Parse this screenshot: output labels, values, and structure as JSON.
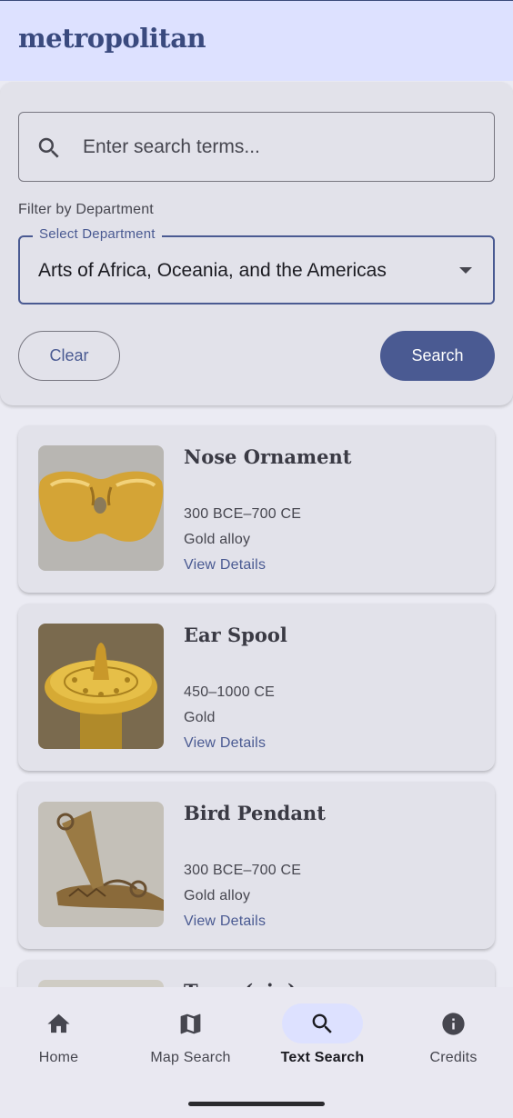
{
  "app": {
    "title": "metropolitan"
  },
  "search": {
    "placeholder": "Enter search terms...",
    "value": ""
  },
  "filter": {
    "label": "Filter by Department",
    "select_label": "Select Department",
    "selected": "Arts of Africa, Oceania, and the Americas"
  },
  "buttons": {
    "clear": "Clear",
    "search": "Search"
  },
  "results": [
    {
      "title": "Nose Ornament",
      "date": "300 BCE–700 CE",
      "medium": "Gold alloy",
      "link": "View Details"
    },
    {
      "title": "Ear Spool",
      "date": "450–1000 CE",
      "medium": "Gold",
      "link": "View Details"
    },
    {
      "title": "Bird Pendant",
      "date": "300 BCE–700 CE",
      "medium": "Gold alloy",
      "link": "View Details"
    },
    {
      "title": "Tupu (pin)"
    }
  ],
  "nav": [
    {
      "label": "Home",
      "icon": "home-icon",
      "active": false
    },
    {
      "label": "Map Search",
      "icon": "map-icon",
      "active": false
    },
    {
      "label": "Text Search",
      "icon": "search-icon",
      "active": true
    },
    {
      "label": "Credits",
      "icon": "info-icon",
      "active": false
    }
  ],
  "colors": {
    "primary": "#4a5a92",
    "top_bar": "#dde1ff",
    "surface": "#e2e2ea",
    "background": "#ebebf3"
  }
}
